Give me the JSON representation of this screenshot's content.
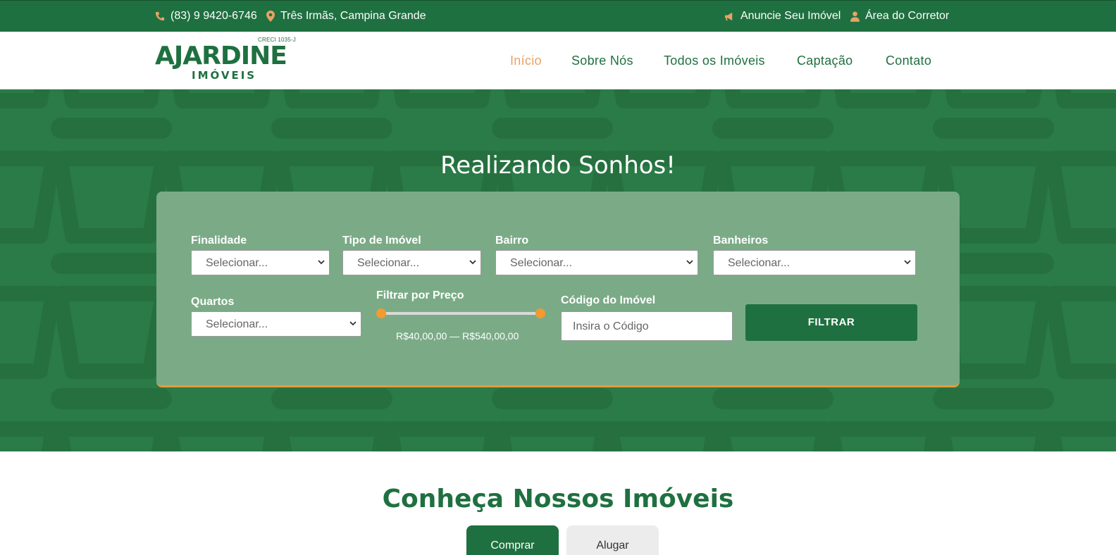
{
  "topbar": {
    "phone": "(83) 9 9420-6746",
    "location": "Três Irmãs, Campina Grande",
    "announce": "Anuncie Seu Imóvel",
    "broker_area": "Área do Corretor"
  },
  "logo": {
    "creci": "CRECI 1035-J",
    "brand": "AJARDINE",
    "sub": "IMÓVEIS"
  },
  "nav": {
    "items": [
      "Início",
      "Sobre Nós",
      "Todos os Imóveis",
      "Captação",
      "Contato"
    ]
  },
  "hero": {
    "title": "Realizando Sonhos!"
  },
  "filters": {
    "finalidade": {
      "label": "Finalidade",
      "value": "Selecionar..."
    },
    "tipo": {
      "label": "Tipo de Imóvel",
      "value": "Selecionar..."
    },
    "bairro": {
      "label": "Bairro",
      "value": "Selecionar..."
    },
    "banheiros": {
      "label": "Banheiros",
      "value": "Selecionar..."
    },
    "quartos": {
      "label": "Quartos",
      "value": "Selecionar..."
    },
    "preco": {
      "label": "Filtrar por Preço",
      "range_text": "R$40,00,00 — R$540,00,00"
    },
    "codigo": {
      "label": "Código do Imóvel",
      "placeholder": "Insira o Código"
    },
    "submit": "FILTRAR"
  },
  "listing": {
    "title": "Conheça Nossos Imóveis",
    "tabs": [
      "Comprar",
      "Alugar"
    ]
  },
  "colors": {
    "primary": "#1f7040",
    "hero_bg": "#2a7b47",
    "accent": "#e8a266",
    "orange": "#f59a2e"
  }
}
